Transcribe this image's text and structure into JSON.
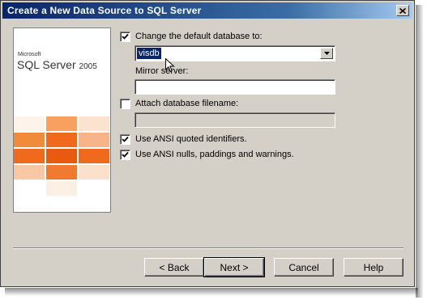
{
  "window": {
    "title": "Create a New Data Source to SQL Server"
  },
  "logo": {
    "maker": "Microsoft",
    "product": "SQL Server",
    "version": "2005"
  },
  "form": {
    "change_db_label": "Change the default database to:",
    "change_db_checked": true,
    "database_value": "visdb",
    "mirror_label": "Mirror server:",
    "mirror_value": "",
    "attach_label": "Attach database filename:",
    "attach_checked": false,
    "attach_value": "",
    "ansi_quoted_label": "Use ANSI quoted identifiers.",
    "ansi_quoted_checked": true,
    "ansi_nulls_label": "Use ANSI nulls, paddings and warnings.",
    "ansi_nulls_checked": true
  },
  "buttons": {
    "back": "< Back",
    "next": "Next >",
    "cancel": "Cancel",
    "help": "Help"
  },
  "icons": {
    "close": "close-icon",
    "dropdown": "chevron-down-icon",
    "check": "check-icon",
    "cursor": "mouse-pointer-icon"
  },
  "colors": {
    "title_bar": "#0a246a",
    "window_face": "#d4d0c8",
    "selection": "#0a246a",
    "logo_orange": "#f06a1a"
  }
}
